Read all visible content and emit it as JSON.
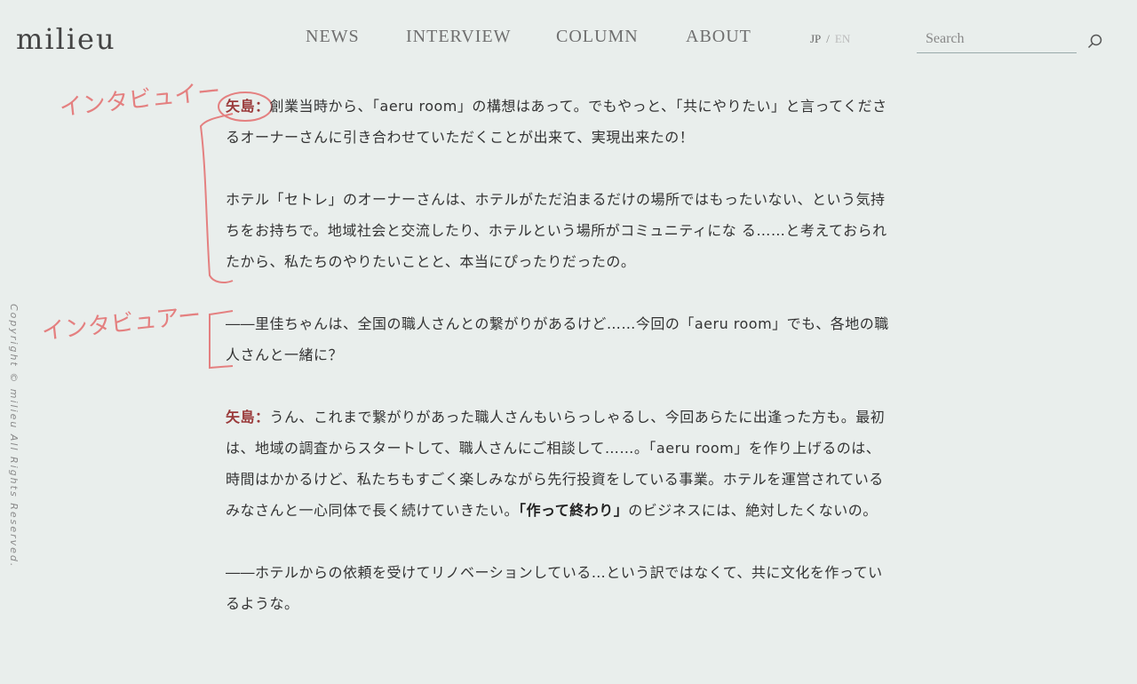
{
  "header": {
    "logo": "milieu",
    "nav": [
      "NEWS",
      "INTERVIEW",
      "COLUMN",
      "ABOUT"
    ],
    "lang": {
      "jp": "JP",
      "sep": "/",
      "en": "EN"
    },
    "search_placeholder": "Search"
  },
  "sidebar": {
    "copyright": "Copyright © milieu All Rights Reserved."
  },
  "annotations": {
    "interviewee": "インタビュイー",
    "interviewer": "インタビュアー",
    "color": "#e07878"
  },
  "article": {
    "p1": {
      "speaker": "矢島：",
      "text": "創業当時から、「aeru room」の構想はあって。でもやっと、「共にやりたい」と言ってくださるオーナーさんに引き合わせていただくことが出来て、実現出来たの！"
    },
    "p2": "ホテル「セトレ」のオーナーさんは、ホテルがただ泊まるだけの場所ではもったいない、という気持ちをお持ちで。地域社会と交流したり、ホテルという場所がコミュニティにな る……と考えておられたから、私たちのやりたいことと、本当にぴったりだったの。",
    "p3": "――里佳ちゃんは、全国の職人さんとの繋がりがあるけど……今回の「aeru room」でも、各地の職人さんと一緒に？",
    "p4": {
      "speaker": "矢島：",
      "text": "うん、これまで繋がりがあった職人さんもいらっしゃるし、今回あらたに出逢った方も。最初は、地域の調査からスタートして、職人さんにご相談して……。「aeru room」を作り上げるのは、時間はかかるけど、私たちもすごく楽しみながら先行投資をしている事業。ホテルを運営されているみなさんと一心同体で長く続けていきたい。",
      "emph": "「作って終わり」",
      "tail": "のビジネスには、絶対したくないの。"
    },
    "p5": "――ホテルからの依頼を受けてリノベーションしている…という訳ではなくて、共に文化を作っているような。"
  }
}
